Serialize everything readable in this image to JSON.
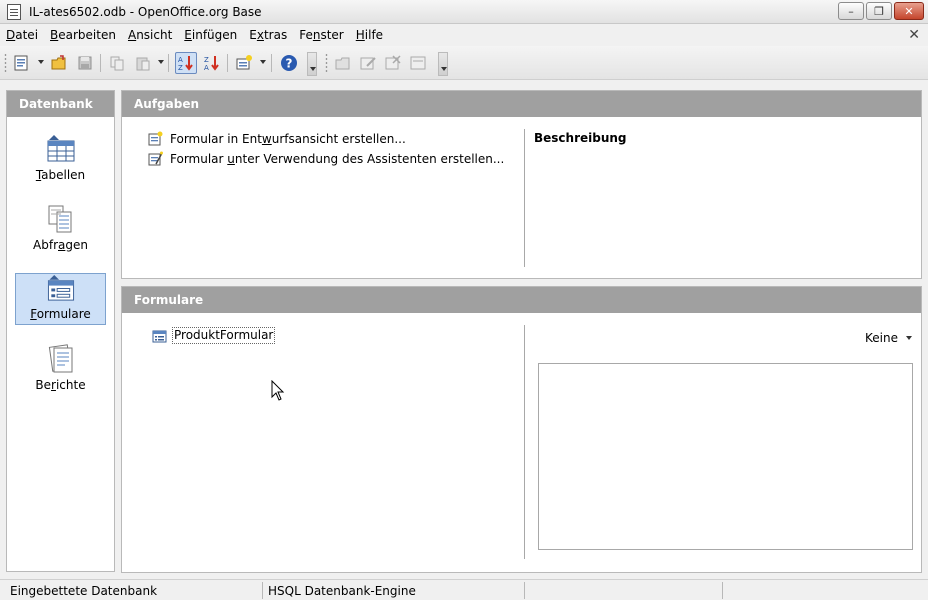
{
  "window": {
    "title": "IL-ates6502.odb - OpenOffice.org Base",
    "minimize_glyph": "–",
    "maximize_glyph": "❐",
    "close_glyph": "✕"
  },
  "menu": {
    "items": [
      {
        "pre": "",
        "key": "D",
        "post": "atei"
      },
      {
        "pre": "",
        "key": "B",
        "post": "earbeiten"
      },
      {
        "pre": "",
        "key": "A",
        "post": "nsicht"
      },
      {
        "pre": "",
        "key": "E",
        "post": "infügen"
      },
      {
        "pre": "E",
        "key": "x",
        "post": "tras"
      },
      {
        "pre": "Fe",
        "key": "n",
        "post": "ster"
      },
      {
        "pre": "",
        "key": "H",
        "post": "ilfe"
      }
    ],
    "doc_close_glyph": "✕"
  },
  "toolbar": {
    "icons": [
      "new-icon",
      "open-icon",
      "save-icon",
      "copy-icon",
      "paste-icon",
      "sort-ascending-icon",
      "sort-descending-icon",
      "form-wizard-icon",
      "help-icon",
      "open-form-icon",
      "edit-form-icon",
      "delete-form-icon",
      "rename-form-icon"
    ]
  },
  "left_panel": {
    "header": "Datenbank",
    "items": [
      {
        "pre": "",
        "key": "T",
        "post": "abellen",
        "icon": "table-icon"
      },
      {
        "pre": "Abfr",
        "key": "a",
        "post": "gen",
        "icon": "query-icon"
      },
      {
        "pre": "",
        "key": "F",
        "post": "ormulare",
        "icon": "form-icon"
      },
      {
        "pre": "Be",
        "key": "r",
        "post": "ichte",
        "icon": "report-icon"
      }
    ]
  },
  "tasks": {
    "header": "Aufgaben",
    "items": [
      {
        "pre": "Formular in Ent",
        "key": "w",
        "post": "urfsansicht erstellen..."
      },
      {
        "pre": "Formular ",
        "key": "u",
        "post": "nter Verwendung des Assistenten erstellen..."
      }
    ],
    "description_title": "Beschreibung"
  },
  "forms": {
    "header": "Formulare",
    "entries": [
      "ProduktFormular"
    ],
    "preview_option": "Keine"
  },
  "statusbar": {
    "left": "Eingebettete Datenbank",
    "middle": "HSQL Datenbank-Engine"
  }
}
